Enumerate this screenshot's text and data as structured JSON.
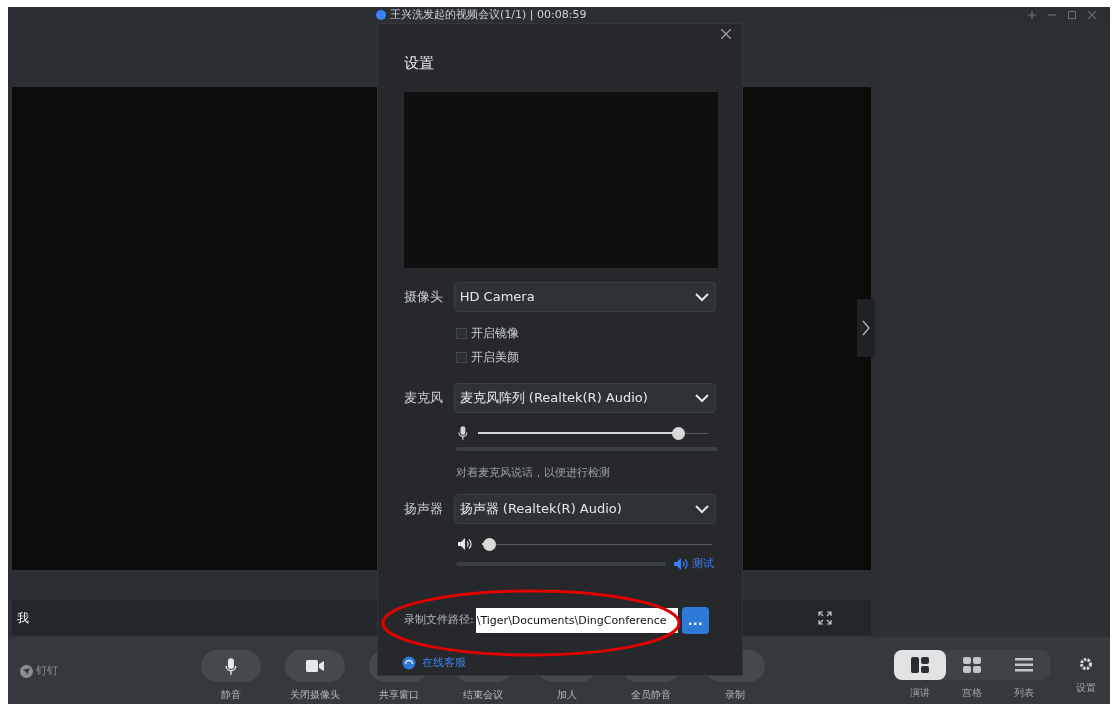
{
  "window": {
    "title": "王兴洗发起的视频会议(1/1) | 00:08:59"
  },
  "participant": {
    "name": "我"
  },
  "app_logo": {
    "label": "钉钉"
  },
  "toolbar": [
    {
      "label": "静音",
      "kind": "mic"
    },
    {
      "label": "关闭摄像头",
      "kind": "camera"
    },
    {
      "label": "共享窗口"
    },
    {
      "label": "结束会议"
    },
    {
      "label": "加人"
    },
    {
      "label": "全员静音"
    },
    {
      "label": "录制"
    }
  ],
  "views": [
    {
      "label": "演讲",
      "kind": "speaker",
      "selected": true
    },
    {
      "label": "宫格",
      "kind": "grid",
      "selected": false
    },
    {
      "label": "列表",
      "kind": "list",
      "selected": false
    }
  ],
  "settings_button": {
    "label": "设置"
  },
  "dialog": {
    "title": "设置",
    "camera": {
      "label": "摄像头",
      "value": "HD Camera"
    },
    "camera_options": [
      {
        "label": "开启镜像",
        "checked": false
      },
      {
        "label": "开启美颜",
        "checked": false
      }
    ],
    "microphone": {
      "label": "麦克风",
      "value": "麦克风阵列 (Realtek(R) Audio)",
      "level": 0.87
    },
    "mic_hint": "对着麦克风说话，以便进行检测",
    "speaker": {
      "label": "扬声器",
      "value": "扬声器 (Realtek(R) Audio)",
      "level": 0.03
    },
    "test_link": "测试",
    "record_path": {
      "label": "录制文件路径:",
      "value": "\\Tiger\\Documents\\DingConference",
      "browse": "..."
    },
    "support_link": "在线客服"
  }
}
